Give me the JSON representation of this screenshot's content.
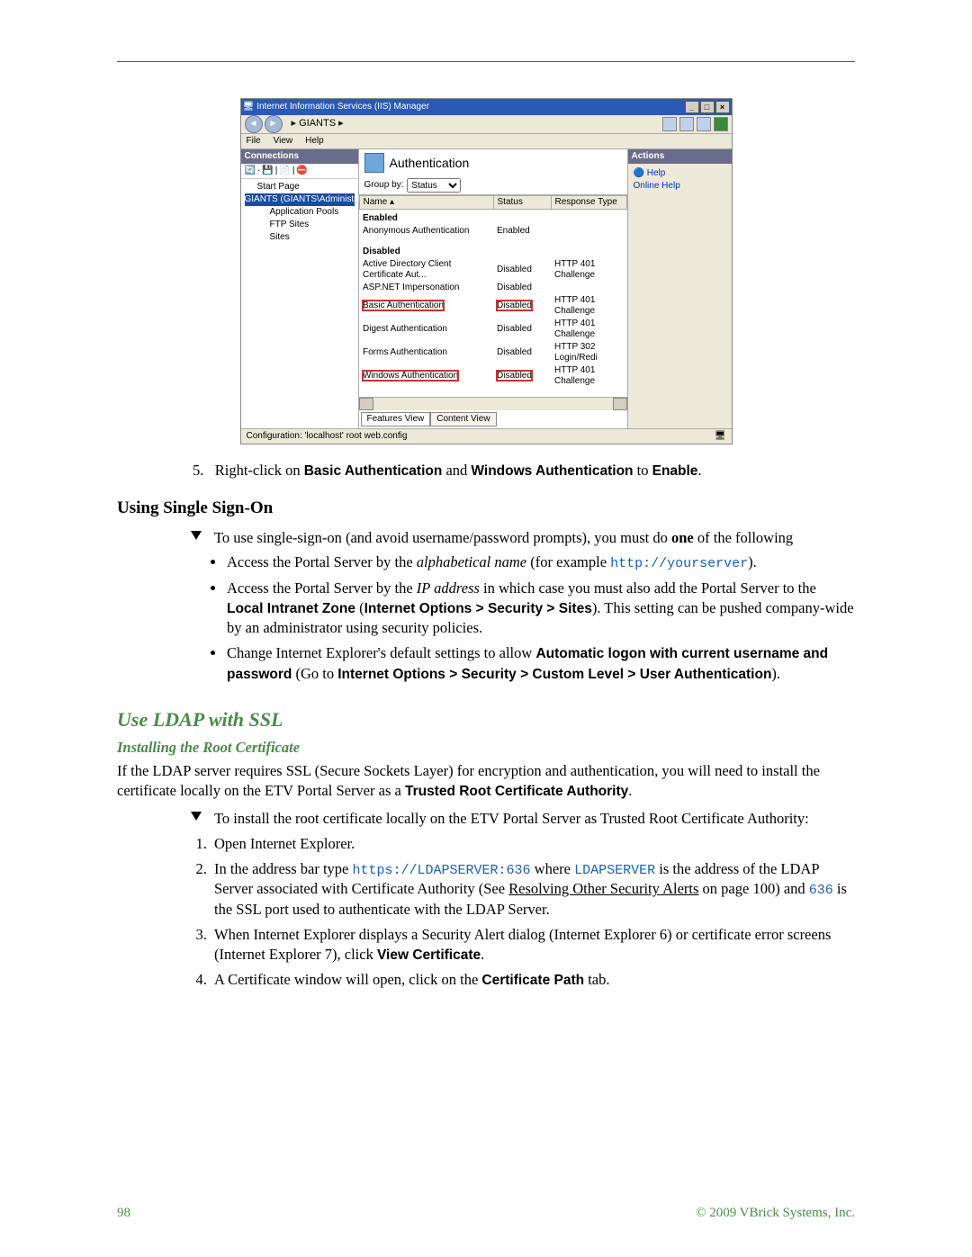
{
  "screenshot": {
    "window_title": "Internet Information Services (IIS) Manager",
    "breadcrumb_prefix": "▸",
    "breadcrumb_item": "GIANTS",
    "breadcrumb_suffix": "▸",
    "menu": {
      "file": "File",
      "view": "View",
      "help": "Help"
    },
    "connections": {
      "title": "Connections",
      "items": {
        "start": "Start Page",
        "server": "GIANTS (GIANTS\\Administrator)",
        "apppools": "Application Pools",
        "ftp": "FTP Sites",
        "sites": "Sites"
      }
    },
    "main": {
      "title": "Authentication",
      "groupby_label": "Group by:",
      "groupby_value": "Status",
      "columns": {
        "name": "Name",
        "status": "Status",
        "response": "Response Type"
      },
      "groups": {
        "enabled": "Enabled",
        "disabled": "Disabled"
      },
      "rows": [
        {
          "name": "Anonymous Authentication",
          "status": "Enabled",
          "response": ""
        },
        {
          "name": "Active Directory Client Certificate Aut...",
          "status": "Disabled",
          "response": "HTTP 401 Challenge"
        },
        {
          "name": "ASP.NET Impersonation",
          "status": "Disabled",
          "response": ""
        },
        {
          "name": "Basic Authentication",
          "status": "Disabled",
          "response": "HTTP 401 Challenge"
        },
        {
          "name": "Digest Authentication",
          "status": "Disabled",
          "response": "HTTP 401 Challenge"
        },
        {
          "name": "Forms Authentication",
          "status": "Disabled",
          "response": "HTTP 302 Login/Redi"
        },
        {
          "name": "Windows Authentication",
          "status": "Disabled",
          "response": "HTTP 401 Challenge"
        }
      ],
      "tabs": {
        "features": "Features View",
        "content": "Content View"
      }
    },
    "actions": {
      "title": "Actions",
      "help": "Help",
      "online": "Online Help"
    },
    "status": "Configuration: 'localhost' root web.config"
  },
  "step5": {
    "num": "5.",
    "t1": "Right-click on ",
    "b1": "Basic Authentication",
    "t2": " and ",
    "b2": "Windows Authentication",
    "t3": " to ",
    "b3": "Enable",
    "t4": "."
  },
  "sso": {
    "heading": "Using Single Sign-On",
    "lead_a": "To use single-sign-on (and avoid username/password prompts), you must do ",
    "lead_b": "one",
    "lead_c": " of the following",
    "b1_a": "Access the Portal Server by the ",
    "b1_i": "alphabetical name",
    "b1_b": " (for example ",
    "b1_code": "http://yourserver",
    "b1_c": ").",
    "b2_a": "Access the Portal Server by the ",
    "b2_i": "IP address",
    "b2_b": " in which case you must also add the Portal Server to the ",
    "b2_bold1": "Local Intranet Zone",
    "b2_c": " (",
    "b2_bold2": "Internet Options > Security > Sites",
    "b2_d": "). This setting can be pushed company-wide by an administrator using security policies.",
    "b3_a": "Change Internet Explorer's default settings to allow ",
    "b3_bold1": "Automatic logon with current username and password",
    "b3_b": " (Go to ",
    "b3_bold2": "Internet Options > Security > Custom Level > User Authentication",
    "b3_c": ")."
  },
  "ldap": {
    "heading": "Use LDAP with SSL",
    "sub": "Installing the Root Certificate",
    "p1_a": "If the LDAP server requires SSL (Secure Sockets Layer) for encryption and authentication, you will need to install the certificate locally on the ETV Portal Server as a ",
    "p1_bold": "Trusted Root Certificate Authority",
    "p1_b": ".",
    "lead": "To install the root certificate locally on the ETV Portal Server as Trusted Root Certificate Authority:",
    "s1": "Open Internet Explorer.",
    "s2_a": "In the address bar type ",
    "s2_code1": "https://LDAPSERVER:636",
    "s2_b": " where ",
    "s2_code2": "LDAPSERVER",
    "s2_c": " is the address of the LDAP Server associated with Certificate Authority (See ",
    "s2_u": "Resolving Other Security Alerts",
    "s2_d": " on page 100) and ",
    "s2_code3": "636",
    "s2_e": " is the SSL port used to authenticate with the LDAP Server.",
    "s3_a": "When Internet Explorer displays a Security Alert dialog (Internet Explorer 6) or certificate error screens (Internet Explorer 7), click ",
    "s3_bold": "View Certificate",
    "s3_b": ".",
    "s4_a": "A Certificate window will open, click on the ",
    "s4_bold": "Certificate Path",
    "s4_b": " tab."
  },
  "footer": {
    "page": "98",
    "copyright": "© 2009 VBrick Systems, Inc."
  }
}
